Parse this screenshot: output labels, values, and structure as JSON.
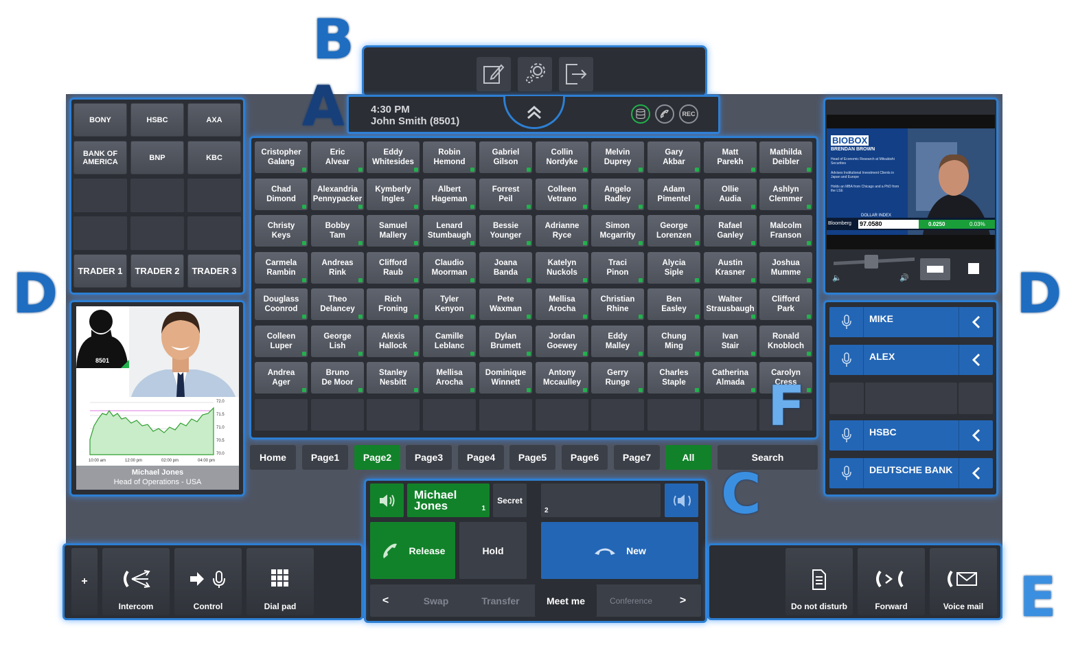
{
  "annotations": {
    "a": "A",
    "b": "B",
    "c": "C",
    "d_left": "D",
    "d_right": "D",
    "e": "E",
    "f": "F"
  },
  "header": {
    "time": "4:30 PM",
    "user": "John Smith (8501)",
    "rec": "REC"
  },
  "quick_keys": {
    "buttons": [
      "BONY",
      "HSBC",
      "AXA",
      "BANK OF\nAMERICA",
      "BNP",
      "KBC"
    ],
    "traders": [
      "TRADER 1",
      "TRADER 2",
      "TRADER 3"
    ]
  },
  "profile": {
    "extension": "8501",
    "name": "Michael Jones",
    "role": "Head of Operations - USA",
    "chart_ticks_y": [
      "72.0",
      "71.5",
      "71.0",
      "70.5",
      "70.0"
    ],
    "chart_ticks_x": [
      "10:00 am",
      "12:00 pm",
      "02:00 pm",
      "04:00 pm"
    ]
  },
  "contacts": [
    [
      "Cristopher\nGalang",
      "Eric\nAlvear",
      "Eddy\nWhitesides",
      "Robin\nHemond",
      "Gabriel\nGilson",
      "Collin\nNordyke",
      "Melvin\nDuprey",
      "Gary\nAkbar",
      "Matt\nParekh",
      "Mathilda\nDeibler"
    ],
    [
      "Chad\nDimond",
      "Alexandria\nPennypacker",
      "Kymberly\nIngles",
      "Albert\nHageman",
      "Forrest\nPeil",
      "Colleen\nVetrano",
      "Angelo\nRadley",
      "Adam\nPimentel",
      "Ollie\nAudia",
      "Ashlyn\nClemmer"
    ],
    [
      "Christy\nKeys",
      "Bobby\nTam",
      "Samuel\nMallery",
      "Lenard\nStumbaugh",
      "Bessie\nYounger",
      "Adrianne\nRyce",
      "Simon\nMcgarrity",
      "George\nLorenzen",
      "Rafael\nGanley",
      "Malcolm\nFranson"
    ],
    [
      "Carmela\nRambin",
      "Andreas\nRink",
      "Clifford\nRaub",
      "Claudio\nMoorman",
      "Joana\nBanda",
      "Katelyn\nNuckols",
      "Traci\nPinon",
      "Alycia\nSiple",
      "Austin\nKrasner",
      "Joshua\nMumme"
    ],
    [
      "Douglass\nCoonrod",
      "Theo\nDelancey",
      "Rich\nFroning",
      "Tyler\nKenyon",
      "Pete\nWaxman",
      "Mellisa\nArocha",
      "Christian\nRhine",
      "Ben\nEasley",
      "Walter\nStrausbaugh",
      "Clifford\nPark"
    ],
    [
      "Colleen\nLuper",
      "George\nLish",
      "Alexis\nHallock",
      "Camille\nLeblanc",
      "Dylan\nBrumett",
      "Jordan\nGoewey",
      "Eddy\nMalley",
      "Chung\nMing",
      "Ivan\nStair",
      "Ronald\nKnobloch"
    ],
    [
      "Andrea\nAger",
      "Bruno\nDe Moor",
      "Stanley\nNesbitt",
      "Mellisa\nArocha",
      "Dominique\nWinnett",
      "Antony\nMccaulley",
      "Gerry\nRunge",
      "Charles\nStaple",
      "Catherina\nAlmada",
      "Carolyn\nCress"
    ]
  ],
  "pages": [
    "Home",
    "Page1",
    "Page2",
    "Page3",
    "Page4",
    "Page5",
    "Page6",
    "Page7",
    "All",
    "Search"
  ],
  "active_page": "Page2",
  "call": {
    "line1_name": "Michael\nJones",
    "line1_num": "1",
    "secret": "Secret",
    "line2_num": "2",
    "release": "Release",
    "hold": "Hold",
    "new": "New",
    "prev": "<",
    "next": ">",
    "swap": "Swap",
    "transfer": "Transfer",
    "meet_me": "Meet me",
    "conference": "Conference"
  },
  "video": {
    "badge": "BIOBOX",
    "anchor": "BRENDAN BROWN",
    "bullet1": "Head of Economic Research at Mitsubishi Securities",
    "bullet2": "Advises Institutional Investment Clients in Japan and Europe",
    "bullet3": "Holds an MBA from Chicago and a PhD from the LSE",
    "ticker_label": "DOLLAR INDEX",
    "ticker_source": "Bloomberg",
    "ticker_value": "97.0580",
    "ticker_change": "0.0250",
    "ticker_pct": "0.03%"
  },
  "intercoms": [
    "MIKE",
    "ALEX",
    "HSBC",
    "DEUTSCHE BANK"
  ],
  "bottom": {
    "plus": "+",
    "intercom": "Intercom",
    "control": "Control",
    "dialpad": "Dial pad",
    "dnd": "Do not disturb",
    "forward": "Forward",
    "voicemail": "Voice mail"
  },
  "colors": {
    "accent": "#2d7fd3",
    "green": "#12822a",
    "blue_btn": "#2366b5"
  }
}
